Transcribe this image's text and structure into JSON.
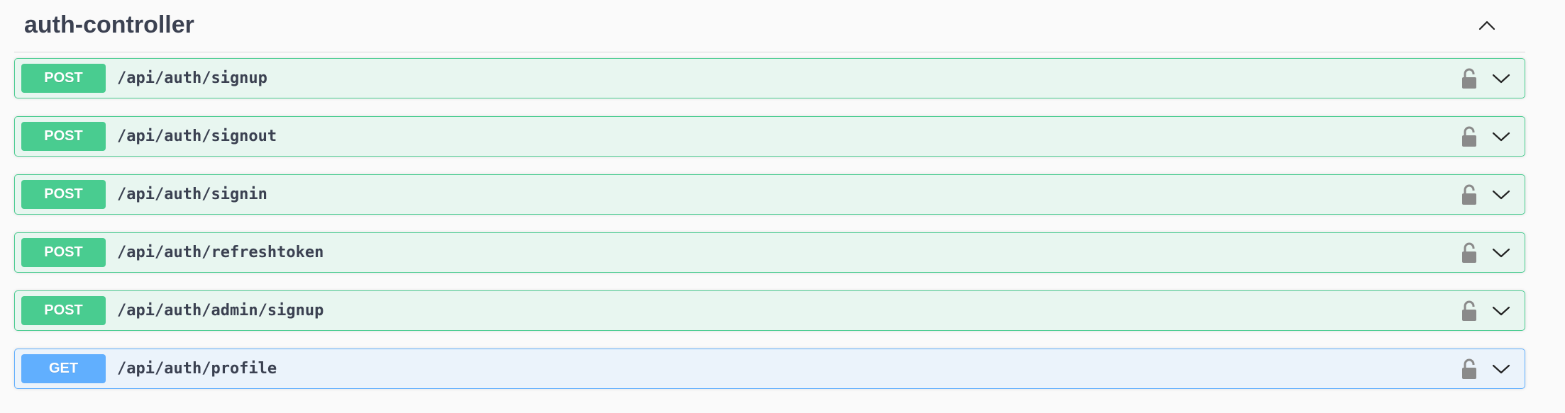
{
  "section": {
    "title": "auth-controller",
    "collapse_icon": "chevron-up-icon"
  },
  "operations": [
    {
      "method": "POST",
      "path": "/api/auth/signup",
      "lock_icon": "unlocked-padlock-icon",
      "expand_icon": "chevron-down-icon"
    },
    {
      "method": "POST",
      "path": "/api/auth/signout",
      "lock_icon": "unlocked-padlock-icon",
      "expand_icon": "chevron-down-icon"
    },
    {
      "method": "POST",
      "path": "/api/auth/signin",
      "lock_icon": "unlocked-padlock-icon",
      "expand_icon": "chevron-down-icon"
    },
    {
      "method": "POST",
      "path": "/api/auth/refreshtoken",
      "lock_icon": "unlocked-padlock-icon",
      "expand_icon": "chevron-down-icon"
    },
    {
      "method": "POST",
      "path": "/api/auth/admin/signup",
      "lock_icon": "unlocked-padlock-icon",
      "expand_icon": "chevron-down-icon"
    },
    {
      "method": "GET",
      "path": "/api/auth/profile",
      "lock_icon": "unlocked-padlock-icon",
      "expand_icon": "chevron-down-icon"
    }
  ],
  "colors": {
    "post_accent": "#49cc90",
    "post_background": "#e8f6f0",
    "get_accent": "#61affe",
    "get_background": "#ebf3fb",
    "title_text": "#3b4151",
    "lock_icon": "#8a8a8a"
  }
}
